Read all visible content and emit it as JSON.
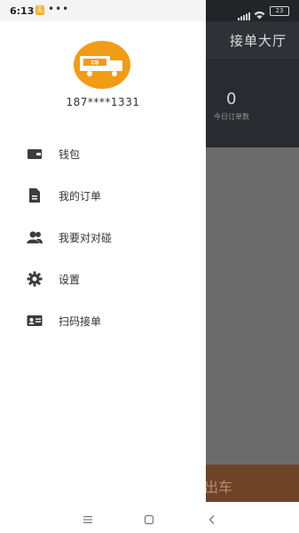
{
  "status": {
    "time": "6:13",
    "badge": "无",
    "dots": "•••",
    "battery": "23"
  },
  "app": {
    "title": "接单大厅",
    "today_count": "0",
    "today_label": "今日订单数",
    "go_button": "出车"
  },
  "drawer": {
    "phone": "187****1331",
    "logo_text": "CB接单",
    "menu": [
      {
        "label": "钱包",
        "icon": "wallet-icon"
      },
      {
        "label": "我的订单",
        "icon": "document-icon"
      },
      {
        "label": "我要对对碰",
        "icon": "users-icon"
      },
      {
        "label": "设置",
        "icon": "gear-icon"
      },
      {
        "label": "扫码接单",
        "icon": "id-card-icon"
      }
    ]
  },
  "colors": {
    "accent": "#f29b16",
    "header": "#2f3136",
    "button": "#6e4328"
  }
}
